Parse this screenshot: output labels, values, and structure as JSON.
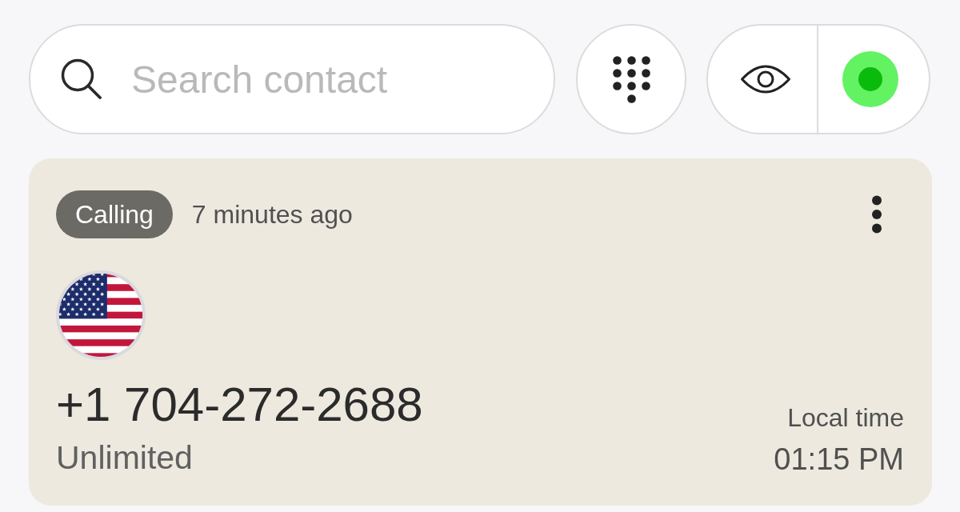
{
  "search": {
    "placeholder": "Search contact"
  },
  "toolbar": {
    "online": true
  },
  "call": {
    "status": "Calling",
    "time_ago": "7 minutes ago",
    "number": "+1 704-272-2688",
    "plan": "Unlimited",
    "local_time_label": "Local time",
    "local_time": "01:15 PM"
  }
}
